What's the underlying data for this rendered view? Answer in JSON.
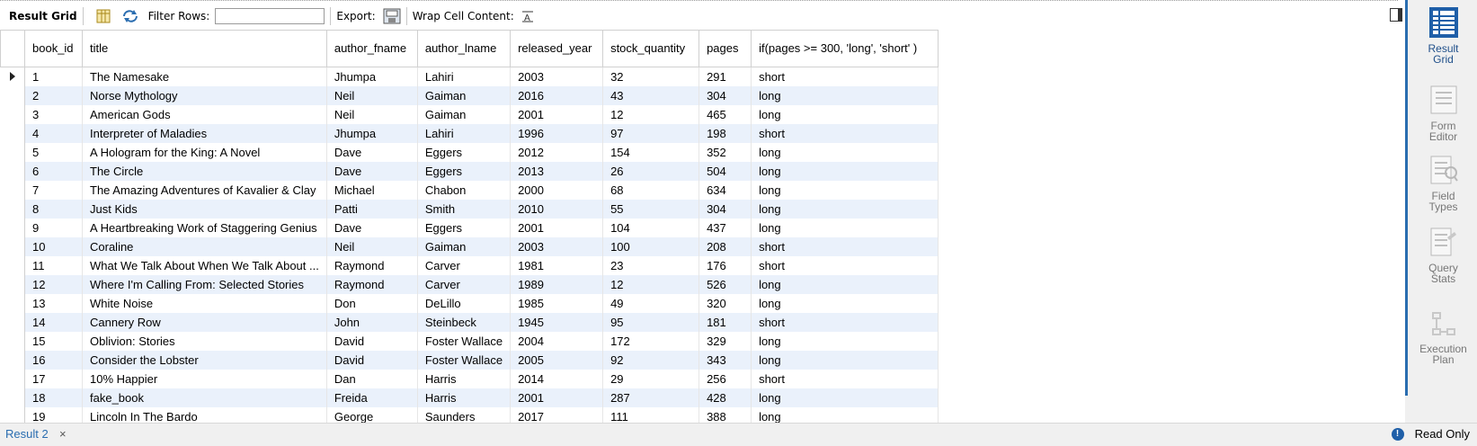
{
  "toolbar": {
    "result_grid_label": "Result Grid",
    "filter_label": "Filter Rows:",
    "filter_value": "",
    "export_label": "Export:",
    "wrap_label": "Wrap Cell Content:"
  },
  "grid": {
    "columns": [
      "book_id",
      "title",
      "author_fname",
      "author_lname",
      "released_year",
      "stock_quantity",
      "pages",
      "if(pages >= 300, 'long', 'short' )"
    ],
    "rows": [
      [
        "1",
        "The Namesake",
        "Jhumpa",
        "Lahiri",
        "2003",
        "32",
        "291",
        "short"
      ],
      [
        "2",
        "Norse Mythology",
        "Neil",
        "Gaiman",
        "2016",
        "43",
        "304",
        "long"
      ],
      [
        "3",
        "American Gods",
        "Neil",
        "Gaiman",
        "2001",
        "12",
        "465",
        "long"
      ],
      [
        "4",
        "Interpreter of Maladies",
        "Jhumpa",
        "Lahiri",
        "1996",
        "97",
        "198",
        "short"
      ],
      [
        "5",
        "A Hologram for the King: A Novel",
        "Dave",
        "Eggers",
        "2012",
        "154",
        "352",
        "long"
      ],
      [
        "6",
        "The Circle",
        "Dave",
        "Eggers",
        "2013",
        "26",
        "504",
        "long"
      ],
      [
        "7",
        "The Amazing Adventures of Kavalier & Clay",
        "Michael",
        "Chabon",
        "2000",
        "68",
        "634",
        "long"
      ],
      [
        "8",
        "Just Kids",
        "Patti",
        "Smith",
        "2010",
        "55",
        "304",
        "long"
      ],
      [
        "9",
        "A Heartbreaking Work of Staggering Genius",
        "Dave",
        "Eggers",
        "2001",
        "104",
        "437",
        "long"
      ],
      [
        "10",
        "Coraline",
        "Neil",
        "Gaiman",
        "2003",
        "100",
        "208",
        "short"
      ],
      [
        "11",
        "What We Talk About When We Talk About ...",
        "Raymond",
        "Carver",
        "1981",
        "23",
        "176",
        "short"
      ],
      [
        "12",
        "Where I'm Calling From: Selected Stories",
        "Raymond",
        "Carver",
        "1989",
        "12",
        "526",
        "long"
      ],
      [
        "13",
        "White Noise",
        "Don",
        "DeLillo",
        "1985",
        "49",
        "320",
        "long"
      ],
      [
        "14",
        "Cannery Row",
        "John",
        "Steinbeck",
        "1945",
        "95",
        "181",
        "short"
      ],
      [
        "15",
        "Oblivion: Stories",
        "David",
        "Foster Wallace",
        "2004",
        "172",
        "329",
        "long"
      ],
      [
        "16",
        "Consider the Lobster",
        "David",
        "Foster Wallace",
        "2005",
        "92",
        "343",
        "long"
      ],
      [
        "17",
        "10% Happier",
        "Dan",
        "Harris",
        "2014",
        "29",
        "256",
        "short"
      ],
      [
        "18",
        "fake_book",
        "Freida",
        "Harris",
        "2001",
        "287",
        "428",
        "long"
      ],
      [
        "19",
        "Lincoln In The Bardo",
        "George",
        "Saunders",
        "2017",
        "111",
        "388",
        "long"
      ]
    ]
  },
  "side_panel": {
    "items": [
      {
        "label": "Result\nGrid",
        "icon": "result-grid-icon",
        "active": true
      },
      {
        "label": "Form\nEditor",
        "icon": "form-editor-icon",
        "active": false
      },
      {
        "label": "Field\nTypes",
        "icon": "field-types-icon",
        "active": false
      },
      {
        "label": "Query\nStats",
        "icon": "query-stats-icon",
        "active": false
      },
      {
        "label": "Execution\nPlan",
        "icon": "execution-plan-icon",
        "active": false
      }
    ]
  },
  "status": {
    "tab_label": "Result 2",
    "close_glyph": "×",
    "readonly_label": "Read Only",
    "info_glyph": "!"
  }
}
